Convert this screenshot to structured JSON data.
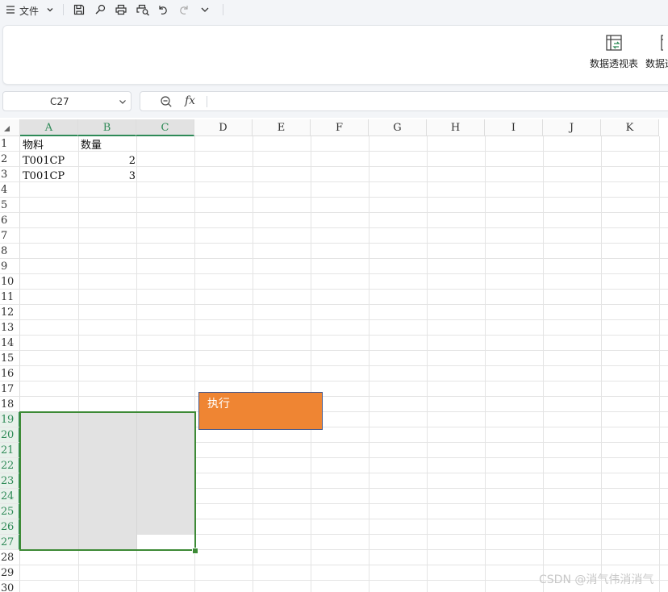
{
  "toolbar": {
    "file_menu": "文件",
    "icons": [
      "menu-icon",
      "save-icon",
      "format-painter-icon",
      "print-icon",
      "print-preview-icon",
      "undo-icon",
      "redo-icon",
      "more-dropdown-icon"
    ]
  },
  "ribbon": {
    "pivot_table_label": "数据透视表",
    "pivot_chart_label": "数据透"
  },
  "formula_bar": {
    "name_box": "C27",
    "fx": "fx",
    "formula": ""
  },
  "sheet": {
    "columns": [
      "A",
      "B",
      "C",
      "D",
      "E",
      "F",
      "G",
      "H",
      "I",
      "J",
      "K"
    ],
    "selected_columns": [
      "A",
      "B",
      "C"
    ],
    "rows": [
      "1",
      "2",
      "3",
      "4",
      "5",
      "6",
      "7",
      "8",
      "9",
      "10",
      "11",
      "12",
      "13",
      "14",
      "15",
      "16",
      "17",
      "18",
      "19",
      "20",
      "21",
      "22",
      "23",
      "24",
      "25",
      "26",
      "27",
      "28",
      "29",
      "30"
    ],
    "selected_rows": [
      "19",
      "20",
      "21",
      "22",
      "23",
      "24",
      "25",
      "26",
      "27"
    ],
    "selection_range": "A19:C27",
    "active_cell": "C27",
    "cells": {
      "A1": "物料",
      "B1": "数量",
      "A2": "T001CP",
      "B2": "2",
      "A3": "T001CP",
      "B3": "3"
    }
  },
  "shape_button": {
    "label": "执行",
    "fill": "#ef8533",
    "border": "#4a5a8a"
  },
  "watermark": "CSDN @消气伟消消气",
  "colors": {
    "selection": "#3d8a36",
    "header_selected_text": "#2e8a57"
  }
}
